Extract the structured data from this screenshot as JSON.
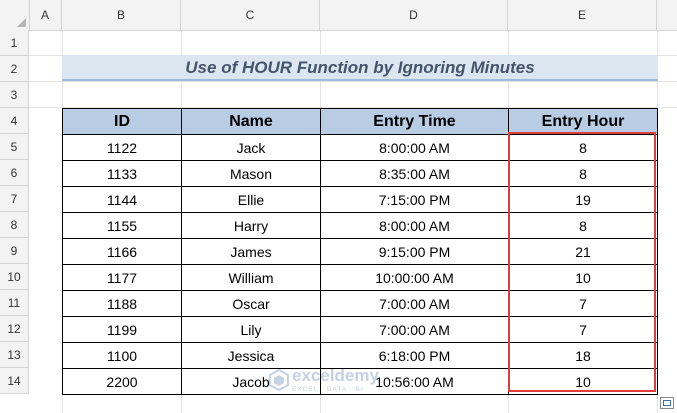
{
  "columns": {
    "a": "A",
    "b": "B",
    "c": "C",
    "d": "D",
    "e": "E"
  },
  "rows": [
    "1",
    "2",
    "3",
    "4",
    "5",
    "6",
    "7",
    "8",
    "9",
    "10",
    "11",
    "12",
    "13",
    "14"
  ],
  "title": "Use of HOUR Function by Ignoring Minutes",
  "headers": {
    "id": "ID",
    "name": "Name",
    "entry_time": "Entry Time",
    "entry_hour": "Entry Hour"
  },
  "records": [
    {
      "id": "1122",
      "name": "Jack",
      "entry_time": "8:00:00 AM",
      "entry_hour": "8"
    },
    {
      "id": "1133",
      "name": "Mason",
      "entry_time": "8:35:00 AM",
      "entry_hour": "8"
    },
    {
      "id": "1144",
      "name": "Ellie",
      "entry_time": "7:15:00 PM",
      "entry_hour": "19"
    },
    {
      "id": "1155",
      "name": "Harry",
      "entry_time": "8:00:00 AM",
      "entry_hour": "8"
    },
    {
      "id": "1166",
      "name": "James",
      "entry_time": "9:15:00 PM",
      "entry_hour": "21"
    },
    {
      "id": "1177",
      "name": "William",
      "entry_time": "10:00:00 AM",
      "entry_hour": "10"
    },
    {
      "id": "1188",
      "name": "Oscar",
      "entry_time": "7:00:00 AM",
      "entry_hour": "7"
    },
    {
      "id": "1199",
      "name": "Lily",
      "entry_time": "7:00:00 AM",
      "entry_hour": "7"
    },
    {
      "id": "1100",
      "name": "Jessica",
      "entry_time": "6:18:00 PM",
      "entry_hour": "18"
    },
    {
      "id": "2200",
      "name": "Jacob",
      "entry_time": "10:56:00 AM",
      "entry_hour": "10"
    }
  ],
  "watermark": {
    "name": "exceldemy",
    "tagline": "EXCEL · DATA · BI"
  },
  "colors": {
    "header_fill": "#b8cce4",
    "title_fill": "#dce6f1",
    "highlight_border": "#e03c3c"
  }
}
